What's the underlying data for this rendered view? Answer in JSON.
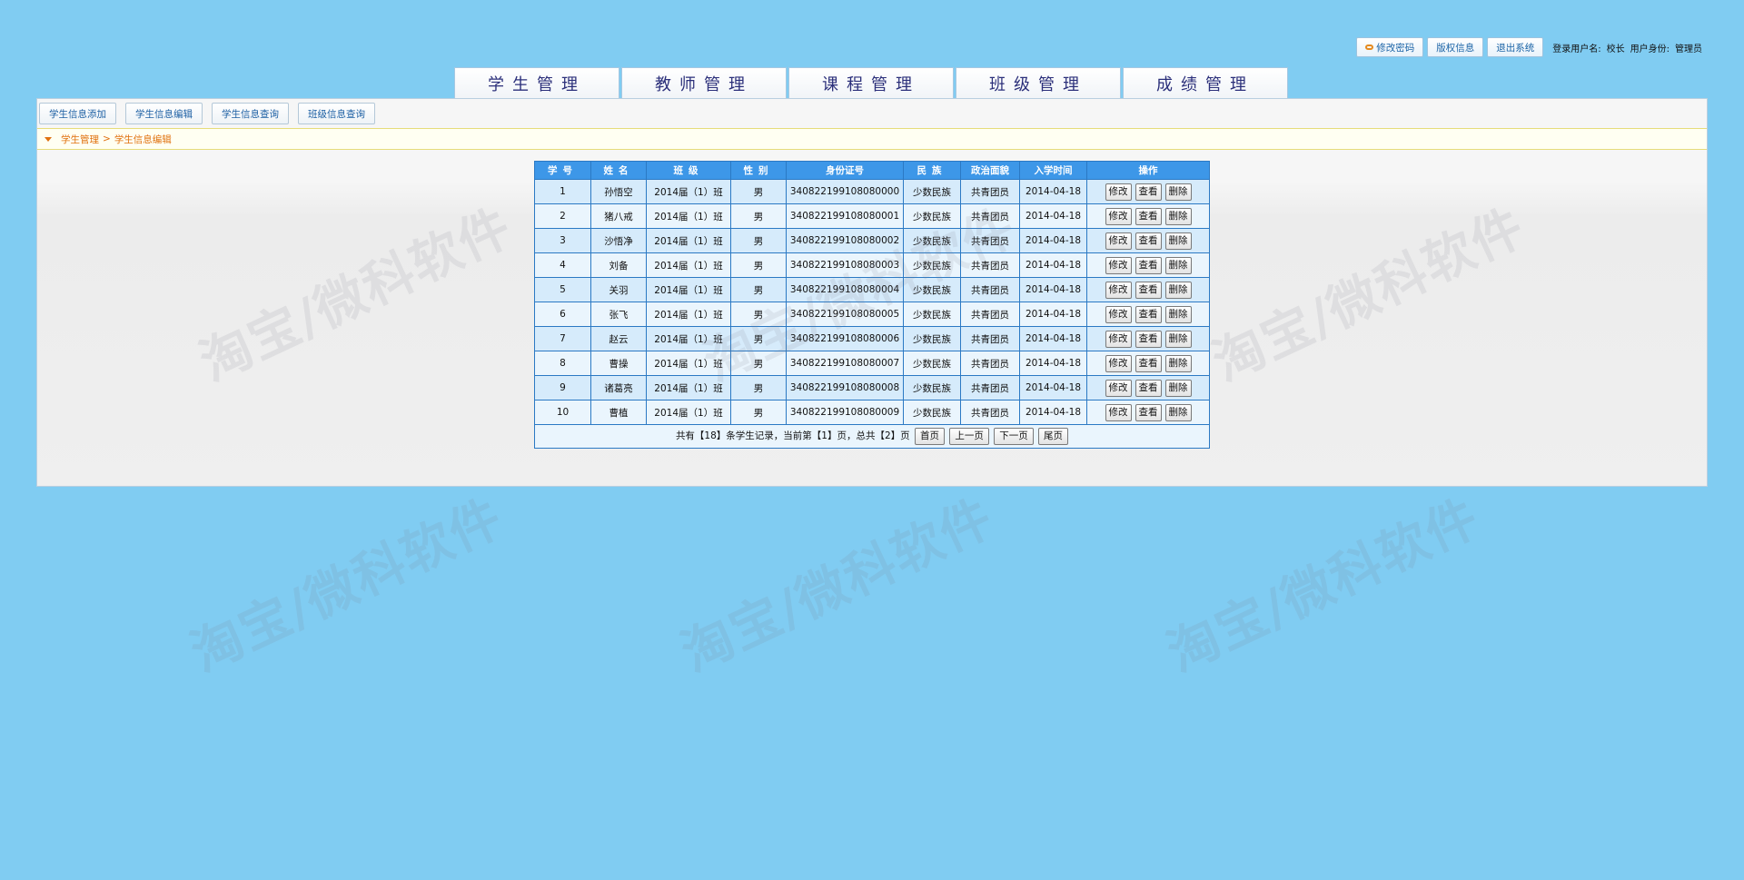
{
  "topbar": {
    "change_password": "修改密码",
    "copyright": "版权信息",
    "logout": "退出系统",
    "username_label": "登录用户名:",
    "username": "校长",
    "role_label": "用户身份:",
    "role": "管理员"
  },
  "nav": {
    "tabs": [
      "学生管理",
      "教师管理",
      "课程管理",
      "班级管理",
      "成绩管理"
    ]
  },
  "subnav": {
    "items": [
      "学生信息添加",
      "学生信息编辑",
      "学生信息查询",
      "班级信息查询"
    ]
  },
  "breadcrumb": {
    "section": "学生管理",
    "separator": ">",
    "page": "学生信息编辑"
  },
  "table": {
    "headers": [
      "学号",
      "姓名",
      "班级",
      "性别",
      "身份证号",
      "民族",
      "政治面貌",
      "入学时间",
      "操作"
    ],
    "actions": [
      "修改",
      "查看",
      "删除"
    ],
    "rows": [
      [
        "1",
        "孙悟空",
        "2014届（1）班",
        "男",
        "340822199108080000",
        "少数民族",
        "共青团员",
        "2014-04-18"
      ],
      [
        "2",
        "猪八戒",
        "2014届（1）班",
        "男",
        "340822199108080001",
        "少数民族",
        "共青团员",
        "2014-04-18"
      ],
      [
        "3",
        "沙悟净",
        "2014届（1）班",
        "男",
        "340822199108080002",
        "少数民族",
        "共青团员",
        "2014-04-18"
      ],
      [
        "4",
        "刘备",
        "2014届（1）班",
        "男",
        "340822199108080003",
        "少数民族",
        "共青团员",
        "2014-04-18"
      ],
      [
        "5",
        "关羽",
        "2014届（1）班",
        "男",
        "340822199108080004",
        "少数民族",
        "共青团员",
        "2014-04-18"
      ],
      [
        "6",
        "张飞",
        "2014届（1）班",
        "男",
        "340822199108080005",
        "少数民族",
        "共青团员",
        "2014-04-18"
      ],
      [
        "7",
        "赵云",
        "2014届（1）班",
        "男",
        "340822199108080006",
        "少数民族",
        "共青团员",
        "2014-04-18"
      ],
      [
        "8",
        "曹操",
        "2014届（1）班",
        "男",
        "340822199108080007",
        "少数民族",
        "共青团员",
        "2014-04-18"
      ],
      [
        "9",
        "诸葛亮",
        "2014届（1）班",
        "男",
        "340822199108080008",
        "少数民族",
        "共青团员",
        "2014-04-18"
      ],
      [
        "10",
        "曹植",
        "2014届（1）班",
        "男",
        "340822199108080009",
        "少数民族",
        "共青团员",
        "2014-04-18"
      ]
    ]
  },
  "pager": {
    "summary": "共有【18】条学生记录，当前第【1】页，总共【2】页",
    "first": "首页",
    "prev": "上一页",
    "next": "下一页",
    "last": "尾页"
  },
  "watermark": "淘宝/微科软件",
  "colors": {
    "background": "#80ccf2",
    "header_blue": "#3d97e8",
    "breadcrumb_orange": "#e0710f",
    "nav_text": "#2b2f7a"
  }
}
